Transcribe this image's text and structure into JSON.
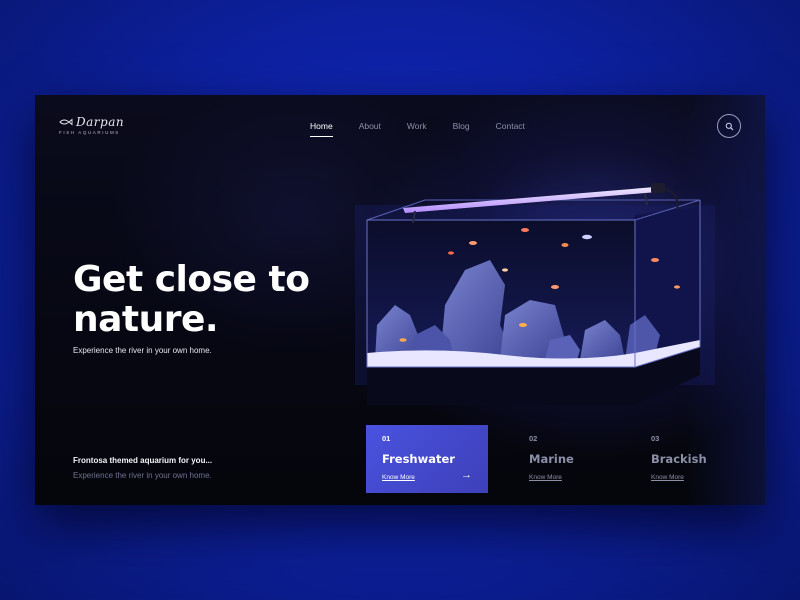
{
  "brand": {
    "name": "Darpan",
    "tagline": "FISH AQUARIUMS"
  },
  "nav": {
    "items": [
      "Home",
      "About",
      "Work",
      "Blog",
      "Contact"
    ],
    "active": "Home"
  },
  "search": {
    "icon": "search-icon"
  },
  "hero": {
    "title_line1": "Get close to",
    "title_line2": "nature.",
    "subtitle": "Experience the river in your own home."
  },
  "promo": {
    "title": "Frontosa themed aquarium for you...",
    "subtitle": "Experience the river in your own home."
  },
  "categories": [
    {
      "number": "01",
      "name": "Freshwater",
      "link": "Know More",
      "active": true,
      "arrow": "→"
    },
    {
      "number": "02",
      "name": "Marine",
      "link": "Know More",
      "active": false
    },
    {
      "number": "03",
      "name": "Brackish",
      "link": "Know More",
      "active": false
    }
  ],
  "colors": {
    "page_background": "#0e22a8",
    "card_background": "#06070f",
    "accent": "#4a52e0",
    "muted_text": "#8c8fa8"
  }
}
